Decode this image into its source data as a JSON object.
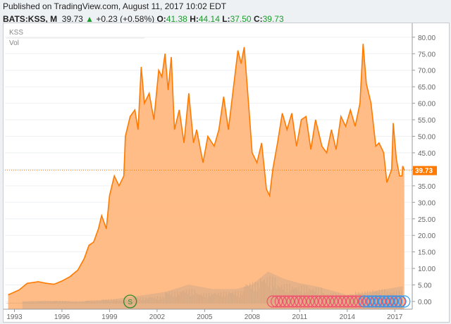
{
  "header": {
    "published": "Published on TradingView.com, August 11, 2017 10:02 EDT",
    "symbol": "BATS:KSS, M",
    "last": "39.73",
    "arrow": "▲",
    "change": "+0.23 (+0.58%)",
    "o_label": "O:",
    "o": "41.38",
    "h_label": "H:",
    "h": "44.14",
    "l_label": "L:",
    "l": "37.50",
    "c_label": "C:",
    "c": "39.73"
  },
  "legend": {
    "series": "KSS",
    "volume": "Vol"
  },
  "colors": {
    "line": "#ff7a00",
    "fill": "#ffb57a",
    "volume": "#d9a77c",
    "ma": "#c9a68a",
    "red_marker": "#f0506e",
    "blue_marker": "#2f9cf0",
    "split": "#2e8b2e"
  },
  "chart_data": {
    "type": "line",
    "title": "KSS monthly",
    "xlabel": "",
    "ylabel": "",
    "ylim": [
      -3,
      84
    ],
    "xlim": [
      1992.4,
      2018.1
    ],
    "x_ticks": [
      "1993",
      "1996",
      "1999",
      "2002",
      "2005",
      "2008",
      "2011",
      "2014",
      "2017"
    ],
    "y_ticks": [
      "80.00",
      "75.00",
      "70.00",
      "65.00",
      "60.00",
      "55.00",
      "50.00",
      "45.00",
      "40.00",
      "35.00",
      "30.00",
      "25.00",
      "20.00",
      "15.00",
      "10.00",
      "5.00",
      "0.00"
    ],
    "last_price_label": "39.73",
    "last_price": 39.73,
    "price": [
      [
        1992.6,
        2
      ],
      [
        1993.3,
        3.5
      ],
      [
        1993.8,
        5.5
      ],
      [
        1994.5,
        6
      ],
      [
        1995,
        5.5
      ],
      [
        1995.5,
        5.2
      ],
      [
        1996,
        6.2
      ],
      [
        1996.5,
        7.5
      ],
      [
        1997,
        9.5
      ],
      [
        1997.4,
        13
      ],
      [
        1997.7,
        17
      ],
      [
        1998,
        18
      ],
      [
        1998.3,
        22
      ],
      [
        1998.5,
        26
      ],
      [
        1998.8,
        22
      ],
      [
        1999,
        32
      ],
      [
        1999.3,
        38
      ],
      [
        1999.6,
        35
      ],
      [
        1999.9,
        38
      ],
      [
        2000,
        50
      ],
      [
        2000.3,
        56
      ],
      [
        2000.6,
        58
      ],
      [
        2000.8,
        52
      ],
      [
        2001,
        71
      ],
      [
        2001.2,
        60
      ],
      [
        2001.5,
        63
      ],
      [
        2001.8,
        55
      ],
      [
        2002.1,
        70
      ],
      [
        2002.3,
        68
      ],
      [
        2002.5,
        75
      ],
      [
        2002.7,
        64
      ],
      [
        2002.9,
        74
      ],
      [
        2003.1,
        52
      ],
      [
        2003.4,
        58
      ],
      [
        2003.7,
        48
      ],
      [
        2004,
        63
      ],
      [
        2004.3,
        48
      ],
      [
        2004.5,
        52
      ],
      [
        2004.9,
        42
      ],
      [
        2005.2,
        50
      ],
      [
        2005.6,
        47
      ],
      [
        2005.9,
        52
      ],
      [
        2006.2,
        62
      ],
      [
        2006.5,
        52
      ],
      [
        2006.9,
        68
      ],
      [
        2007.1,
        76
      ],
      [
        2007.3,
        72
      ],
      [
        2007.5,
        77
      ],
      [
        2007.8,
        58
      ],
      [
        2008,
        45
      ],
      [
        2008.3,
        42
      ],
      [
        2008.6,
        48
      ],
      [
        2008.9,
        34
      ],
      [
        2009.1,
        32
      ],
      [
        2009.3,
        40
      ],
      [
        2009.6,
        48
      ],
      [
        2009.9,
        57
      ],
      [
        2010.2,
        52
      ],
      [
        2010.5,
        57
      ],
      [
        2010.8,
        47
      ],
      [
        2011.1,
        55
      ],
      [
        2011.4,
        56
      ],
      [
        2011.7,
        46
      ],
      [
        2012,
        55
      ],
      [
        2012.4,
        47
      ],
      [
        2012.7,
        45
      ],
      [
        2013,
        52
      ],
      [
        2013.3,
        46
      ],
      [
        2013.6,
        56
      ],
      [
        2013.9,
        53
      ],
      [
        2014.2,
        58
      ],
      [
        2014.5,
        53
      ],
      [
        2014.8,
        60
      ],
      [
        2015,
        78
      ],
      [
        2015.2,
        66
      ],
      [
        2015.5,
        60
      ],
      [
        2015.8,
        47
      ],
      [
        2016,
        48
      ],
      [
        2016.3,
        45
      ],
      [
        2016.5,
        36
      ],
      [
        2016.8,
        40
      ],
      [
        2016.9,
        54
      ],
      [
        2017.1,
        43
      ],
      [
        2017.3,
        38
      ],
      [
        2017.45,
        38
      ],
      [
        2017.5,
        41
      ],
      [
        2017.6,
        39.73
      ]
    ],
    "volume": [
      [
        1993,
        0.5
      ],
      [
        1994,
        1
      ],
      [
        1995,
        1.2
      ],
      [
        1996,
        1.5
      ],
      [
        1997,
        1
      ],
      [
        1998,
        1.8
      ],
      [
        1999,
        2.5
      ],
      [
        2000,
        2
      ],
      [
        2001,
        3.5
      ],
      [
        2002,
        4
      ],
      [
        2003,
        7
      ],
      [
        2004,
        8
      ],
      [
        2005,
        6
      ],
      [
        2006,
        6.5
      ],
      [
        2007,
        7
      ],
      [
        2008,
        12
      ],
      [
        2009,
        15
      ],
      [
        2010,
        11
      ],
      [
        2011,
        10
      ],
      [
        2012,
        9
      ],
      [
        2013,
        6
      ],
      [
        2014,
        5
      ],
      [
        2015,
        7
      ],
      [
        2016,
        8
      ],
      [
        2017,
        7
      ]
    ],
    "volume_ma": [
      [
        1993.5,
        0.8
      ],
      [
        1995,
        1
      ],
      [
        1997,
        0.8
      ],
      [
        1999,
        1.3
      ],
      [
        2001,
        2.8
      ],
      [
        2002.5,
        4
      ],
      [
        2004,
        6.5
      ],
      [
        2005.5,
        5
      ],
      [
        2007,
        5
      ],
      [
        2008,
        6.5
      ],
      [
        2009,
        11
      ],
      [
        2010,
        8.5
      ],
      [
        2011,
        7
      ],
      [
        2012,
        6
      ],
      [
        2013,
        4.5
      ],
      [
        2014,
        3
      ],
      [
        2015,
        3.5
      ],
      [
        2016,
        4.5
      ],
      [
        2017.5,
        6
      ]
    ],
    "split_marker": {
      "label": "S",
      "x": 2000.3
    },
    "dividend_markers": {
      "red_range": [
        2009.3,
        2017.3
      ],
      "blue_range": [
        2015.1,
        2017.6
      ]
    }
  }
}
